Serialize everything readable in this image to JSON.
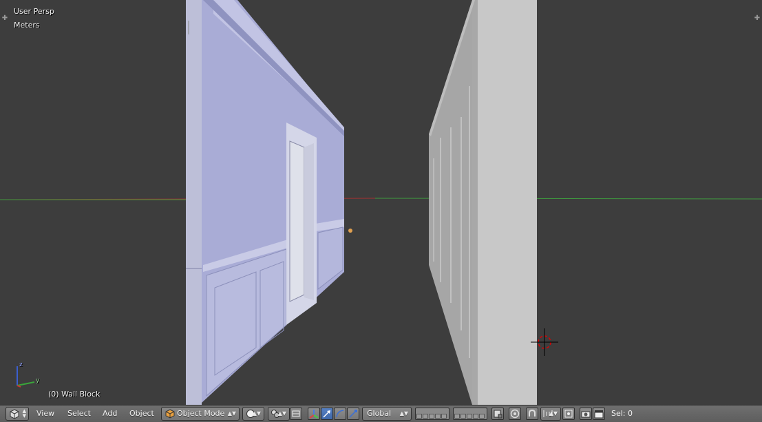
{
  "viewport": {
    "view_name": "User Persp",
    "units": "Meters",
    "selected_object": "(0) Wall Block",
    "axis_labels": {
      "z": "z",
      "y": "y"
    }
  },
  "header": {
    "menus": [
      "View",
      "Select",
      "Add",
      "Object"
    ],
    "mode": "Object Mode",
    "orientation": "Global",
    "selection_count": "Sel: 0"
  },
  "colors": {
    "viewport_bg": "#3d3d3d",
    "wall_left": "#a9acd6",
    "wall_right": "#c8c8c8",
    "x_axis": "#a33232",
    "y_axis": "#3f9a3f",
    "toolbar_bg": "#666666"
  },
  "icons": {
    "editor_type": "cube-icon",
    "viewport_shading": "sphere-icon",
    "pivot": "pivot-icon",
    "manipulator": "manipulator-icon",
    "translate": "translate-icon",
    "rotate": "rotate-icon",
    "scale": "scale-icon",
    "proportional": "proportional-edit-icon",
    "snap": "magnet-icon",
    "render": "camera-icon",
    "anim": "clapperboard-icon"
  }
}
